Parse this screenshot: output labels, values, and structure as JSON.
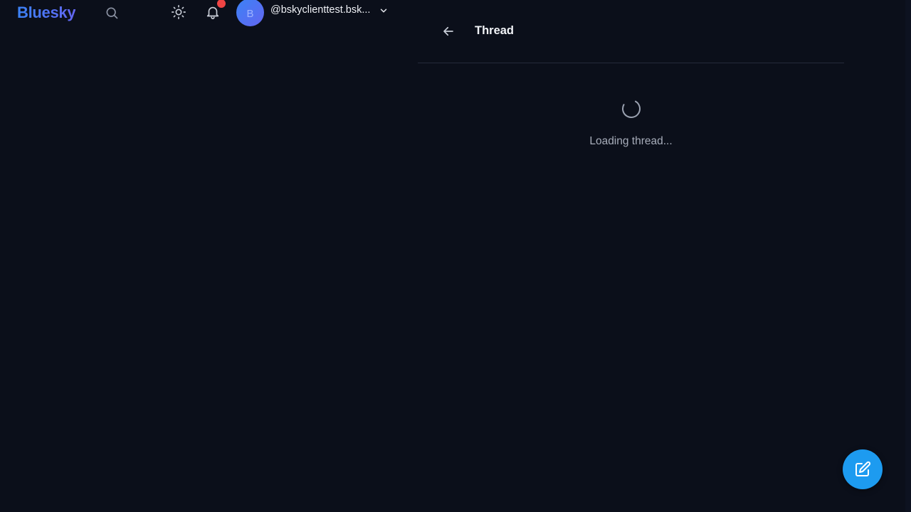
{
  "brand": {
    "name": "Bluesky"
  },
  "nav": {
    "search_icon": "search-icon",
    "theme_icon": "sun-icon",
    "notifications_icon": "bell-icon",
    "notification_badge_color": "#ef4444"
  },
  "account": {
    "avatar_initial": "B",
    "handle": "@bskyclienttest.bsk...",
    "menu_icon": "chevron-down-icon"
  },
  "thread": {
    "back_icon": "arrow-left-icon",
    "title": "Thread",
    "loading_text": "Loading thread..."
  },
  "compose": {
    "icon": "pencil-square-icon",
    "color": "#1d9bf0"
  },
  "colors": {
    "background": "#0b0f1a",
    "brand_gradient": [
      "#3b82f6",
      "#6366f1"
    ],
    "divider": "#252b3a"
  }
}
